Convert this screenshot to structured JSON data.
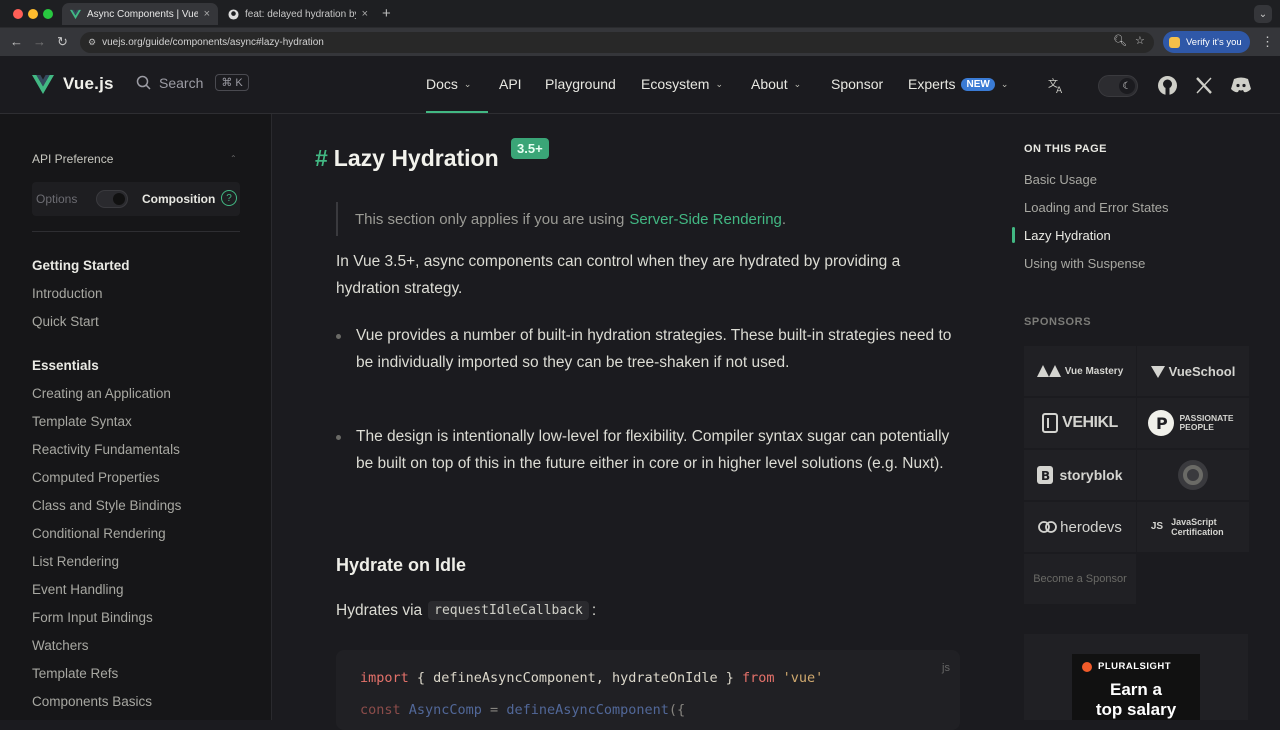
{
  "browser": {
    "tabs": [
      {
        "title": "Async Components | Vue.js",
        "close": "×"
      },
      {
        "title": "feat: delayed hydration by Ga...",
        "close": "×"
      }
    ],
    "new_tab": "+",
    "url": "vuejs.org/guide/components/async#lazy-hydration",
    "verify_label": "Verify it's you"
  },
  "nav": {
    "logo_text": "Vue.js",
    "search_label": "Search",
    "search_kbd": "⌘ K",
    "items": [
      {
        "label": "Docs",
        "has_chevron": true
      },
      {
        "label": "API",
        "has_chevron": false
      },
      {
        "label": "Playground",
        "has_chevron": false
      },
      {
        "label": "Ecosystem",
        "has_chevron": true
      },
      {
        "label": "About",
        "has_chevron": true
      },
      {
        "label": "Sponsor",
        "has_chevron": false
      },
      {
        "label": "Experts",
        "has_chevron": true
      }
    ],
    "experts_badge": "NEW",
    "accent_color": "#42b883"
  },
  "sidebar": {
    "pref_title": "API Preference",
    "pref_options": "Options",
    "pref_composition": "Composition",
    "pref_help": "?",
    "groups": [
      {
        "title": "Getting Started",
        "items": [
          "Introduction",
          "Quick Start"
        ]
      },
      {
        "title": "Essentials",
        "items": [
          "Creating an Application",
          "Template Syntax",
          "Reactivity Fundamentals",
          "Computed Properties",
          "Class and Style Bindings",
          "Conditional Rendering",
          "List Rendering",
          "Event Handling",
          "Form Input Bindings",
          "Watchers",
          "Template Refs",
          "Components Basics"
        ]
      }
    ]
  },
  "main": {
    "heading": "Lazy Hydration",
    "heading_hash": "#",
    "version_badge": "3.5+",
    "tip_text": "This section only applies if you are using",
    "tip_link": "Server-Side Rendering",
    "tip_end": ".",
    "intro": "In Vue 3.5+, async components can control when they are hydrated by providing a hydration strategy.",
    "bullets": [
      "Vue provides a number of built-in hydration strategies. These built-in strategies need to be individually imported so they can be tree-shaken if not used.",
      "The design is intentionally low-level for flexibility. Compiler syntax sugar can potentially be built on top of this in the future either in core or in higher level solutions (e.g. Nuxt)."
    ],
    "subheading": "Hydrate on Idle",
    "hydrate_text": "Hydrates via",
    "hydrate_code": "requestIdleCallback",
    "hydrate_end": ":",
    "code_lang": "js",
    "code_line1": {
      "kw": "import",
      "mid": " { defineAsyncComponent, hydrateOnIdle } ",
      "kw2": "from",
      "str": " 'vue'"
    },
    "code_line2": {
      "kw": "const",
      "name": " AsyncComp ",
      "mid": "= ",
      "fn": "defineAsyncComponent",
      "end": "({"
    }
  },
  "aside": {
    "title": "ON THIS PAGE",
    "outline": [
      "Basic Usage",
      "Loading and Error States",
      "Lazy Hydration",
      "Using with Suspense"
    ],
    "active_index": 2,
    "sponsors_title": "SPONSORS",
    "sponsors": [
      "Vue Mastery",
      "VueSchool",
      "VEHIKL",
      "PASSIONATE PEOPLE",
      "storyblok",
      "",
      "herodevs",
      "JavaScript Certification"
    ],
    "become_sponsor": "Become a Sponsor",
    "ad_brand": "PLURALSIGHT",
    "ad_line1": "Earn a",
    "ad_line2": "top salary"
  }
}
